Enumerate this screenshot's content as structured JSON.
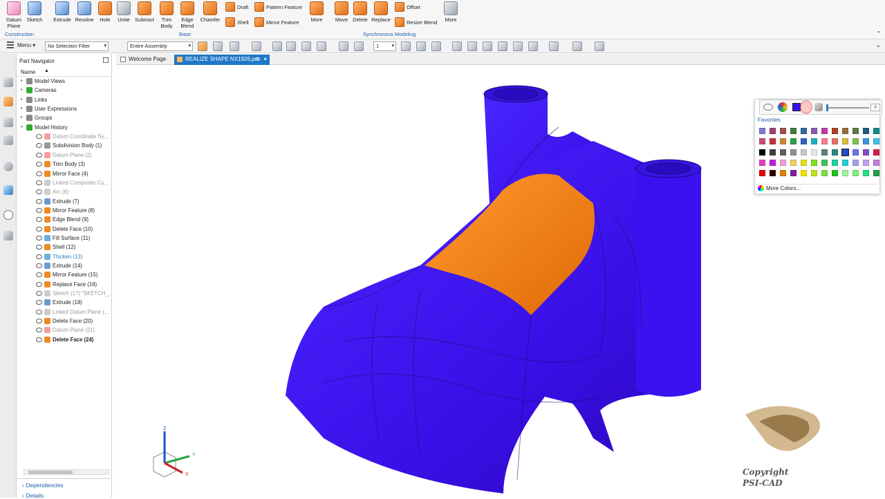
{
  "ribbon": {
    "construction": {
      "datum_plane": "Datum",
      "datum_plane2": "Plane",
      "sketch": "Sketch",
      "group": "Construction"
    },
    "base": {
      "extrude": "Extrude",
      "revolve": "Revolve",
      "hole": "Hole",
      "unite": "Unite",
      "subtract": "Subtract",
      "trim_body": "Trim",
      "trim_body2": "Body",
      "edge_blend": "Edge",
      "edge_blend2": "Blend",
      "chamfer": "Chamfer",
      "draft": "Draft",
      "shell": "Shell",
      "pattern_feature": "Pattern Feature",
      "mirror_feature": "Mirror Feature",
      "more": "More",
      "group": "Base"
    },
    "sync": {
      "move": "Move",
      "delete": "Delete",
      "replace": "Replace",
      "offset": "Offset",
      "resize_blend": "Resize Blend",
      "more": "More",
      "group": "Synchronous Modeling"
    }
  },
  "toolbar": {
    "menu": "Menu",
    "selection_filter": "No Selection Filter",
    "scope": "Entire Assembly",
    "layer": "1"
  },
  "navigator": {
    "title": "Part Navigator",
    "column": "Name",
    "items": [
      {
        "label": "Model Views"
      },
      {
        "label": "Cameras"
      },
      {
        "label": "Links"
      },
      {
        "label": "User Expressions"
      },
      {
        "label": "Groups"
      },
      {
        "label": "Model History"
      },
      {
        "label": "Datum Coordinate Sy..."
      },
      {
        "label": "Subdivision Body (1)"
      },
      {
        "label": "Datum Plane (2)"
      },
      {
        "label": "Trim Body (3)"
      },
      {
        "label": "Mirror Face (4)"
      },
      {
        "label": "Linked Composite Cu..."
      },
      {
        "label": "Arc (6)"
      },
      {
        "label": "Extrude (7)"
      },
      {
        "label": "Mirror Feature (8)"
      },
      {
        "label": "Edge Blend (9)"
      },
      {
        "label": "Delete Face (10)"
      },
      {
        "label": "Fill Surface (11)"
      },
      {
        "label": "Shell (12)"
      },
      {
        "label": "Thicken (13)"
      },
      {
        "label": "Extrude (14)"
      },
      {
        "label": "Mirror Feature (15)"
      },
      {
        "label": "Replace Face (16)"
      },
      {
        "label": "Sketch (17) \"SKETCH_..."
      },
      {
        "label": "Extrude (18)"
      },
      {
        "label": "Linked Datum Plane (..."
      },
      {
        "label": "Delete Face (20)"
      },
      {
        "label": "Datum Plane (21)"
      },
      {
        "label": "Delete Face (24)"
      }
    ],
    "dependencies": "Dependencies",
    "details": "Details"
  },
  "tabs": [
    {
      "label": "Welcome Page"
    },
    {
      "label": "REALIZE SHAPE NX1926.prt"
    }
  ],
  "color_picker": {
    "favorites_label": "Favorites",
    "more_colors": "More Colors...",
    "slider_value": "0",
    "swatches": [
      [
        "#7b7bd0",
        "#a04070",
        "#a05050",
        "#3d7a3d",
        "#2d6a9a",
        "#8a5aa8",
        "#c03aa8",
        "#b0402a",
        "#986a3a",
        "#607848",
        "#1d5f7f",
        "#108a8a"
      ],
      [
        "#c85070",
        "#c83040",
        "#c88a30",
        "#30a040",
        "#3060c0",
        "#20b0c0",
        "#f08090",
        "#e8706a",
        "#d8c040",
        "#80c050",
        "#4090e0",
        "#40c0e8"
      ],
      [
        "#000000",
        "#404040",
        "#606060",
        "#909090",
        "#c8c8c8",
        "#e8e8e8",
        "#608080",
        "#308880",
        "#2050d0",
        "#7070f0",
        "#8050c8",
        "#d02050"
      ],
      [
        "#e040c0",
        "#c020e0",
        "#f0a0d0",
        "#f0d060",
        "#e0e020",
        "#80e020",
        "#40c060",
        "#20d0a0",
        "#20d0d0",
        "#a0a0f0",
        "#c0a0f0",
        "#c080e0"
      ],
      [
        "#e00000",
        "#300000",
        "#e08000",
        "#8020a0",
        "#f0e000",
        "#c0e020",
        "#80e040",
        "#20c020",
        "#a0f0a0",
        "#80f080",
        "#20e080",
        "#20a040"
      ]
    ]
  },
  "watermark": {
    "line1": "Copyright",
    "line2": "PSI-CAD"
  },
  "triad": {
    "x": "X",
    "y": "Y",
    "z": "Z"
  },
  "colors": {
    "body": "#3a10e8",
    "face_highlight": "#f07a12",
    "accent": "#1e78c8"
  }
}
